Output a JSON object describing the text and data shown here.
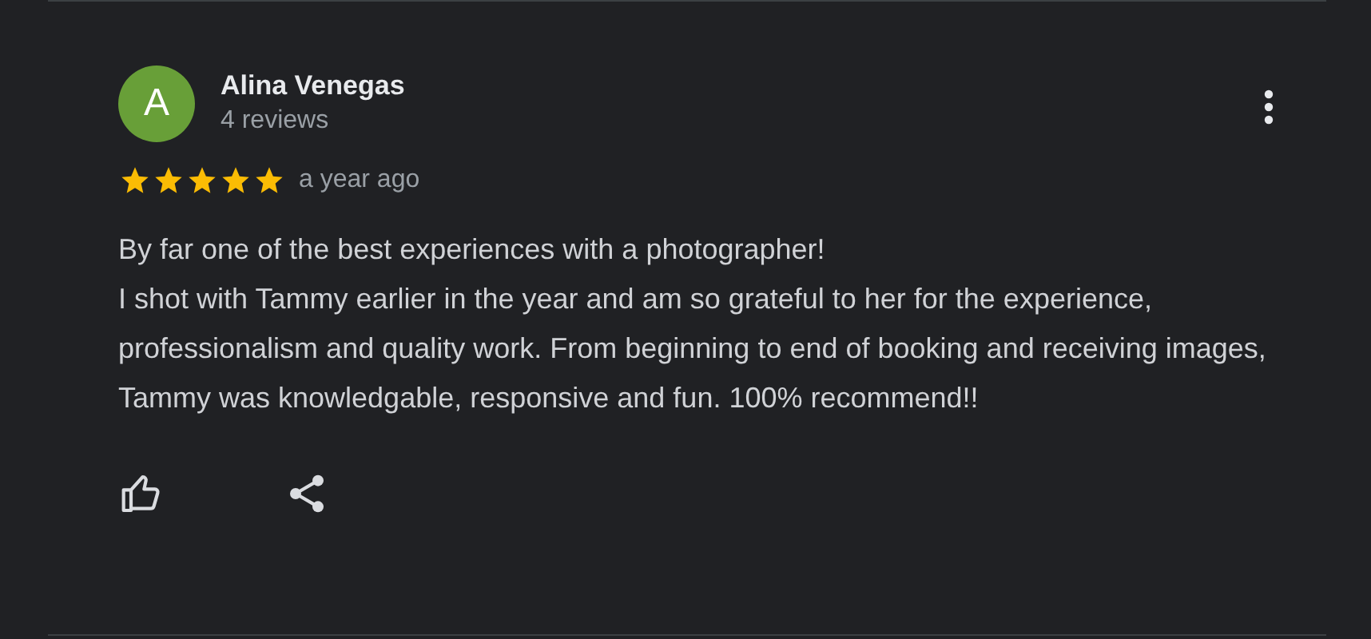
{
  "review": {
    "avatar_letter": "A",
    "reviewer": "Alina Venegas",
    "review_count": "4 reviews",
    "stars": 5,
    "time": "a year ago",
    "text": "By far one of the best experiences with a photographer!\nI shot with Tammy earlier in the year and am so grateful to her for the experience, professionalism and quality work. From beginning to end of booking and receiving images, Tammy was knowledgable, responsive and fun. 100% recommend!!"
  }
}
